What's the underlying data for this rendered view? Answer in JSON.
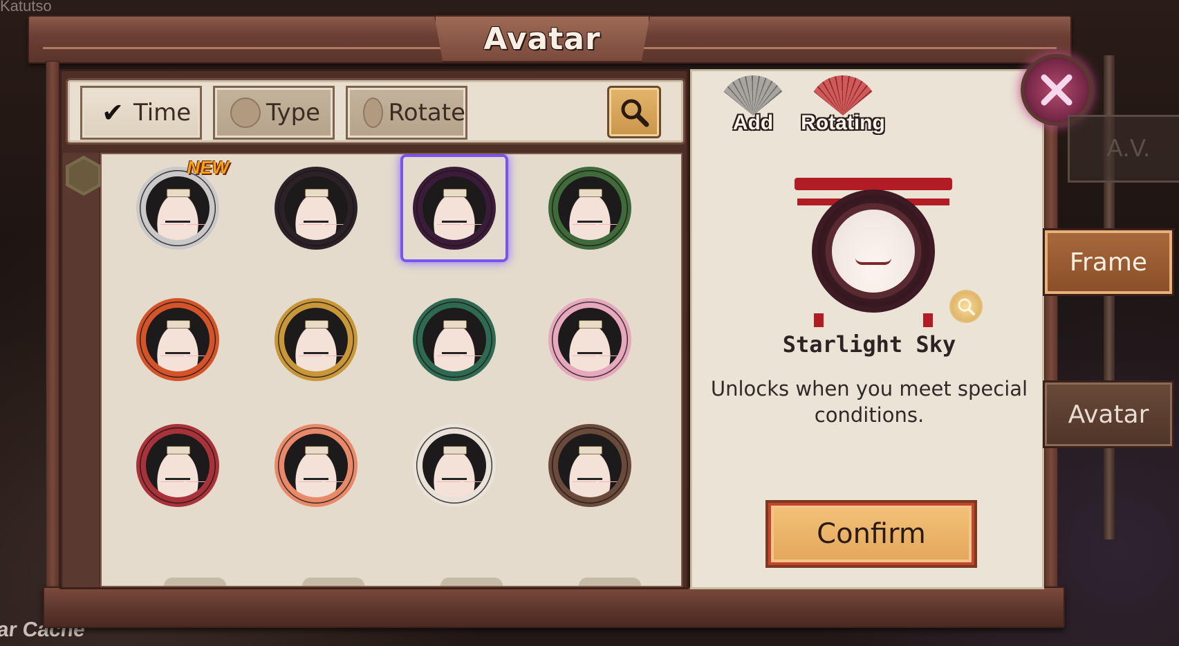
{
  "background": {
    "top_left_text": "Katutso",
    "bottom_left_text": "ar Cache"
  },
  "window": {
    "title": "Avatar"
  },
  "filters": {
    "items": [
      {
        "label": "Time",
        "checked": true
      },
      {
        "label": "Type",
        "checked": false
      },
      {
        "label": "Rotate",
        "checked": false
      }
    ],
    "check_glyph": "✔",
    "search_icon": "search-icon"
  },
  "grid": {
    "new_badge": "NEW",
    "items": [
      {
        "name": "frame-silver-8",
        "ring_color": "#c9c9c9",
        "is_new": true,
        "selected": false
      },
      {
        "name": "frame-default",
        "ring_color": "#2a2226",
        "is_new": false,
        "selected": false
      },
      {
        "name": "frame-starlight-sky",
        "ring_color": "#3a1c3a",
        "is_new": false,
        "selected": true
      },
      {
        "name": "frame-serpent-green",
        "ring_color": "#3f6a3a",
        "is_new": false,
        "selected": false
      },
      {
        "name": "frame-autumn-leaf",
        "ring_color": "#d4542a",
        "is_new": false,
        "selected": false
      },
      {
        "name": "frame-golden-blade",
        "ring_color": "#c8973a",
        "is_new": false,
        "selected": false
      },
      {
        "name": "frame-green-vine",
        "ring_color": "#2e6a52",
        "is_new": false,
        "selected": false
      },
      {
        "name": "frame-sakura-gold",
        "ring_color": "#e6a8bc",
        "is_new": false,
        "selected": false
      },
      {
        "name": "frame-oni-festival",
        "ring_color": "#a8323a",
        "is_new": false,
        "selected": false
      },
      {
        "name": "frame-coral-bloom",
        "ring_color": "#e88a6a",
        "is_new": false,
        "selected": false
      },
      {
        "name": "frame-white-fox",
        "ring_color": "#e8e2d8",
        "is_new": false,
        "selected": false
      },
      {
        "name": "frame-pink-blossom",
        "ring_color": "#6a4a3a",
        "is_new": false,
        "selected": false
      }
    ]
  },
  "detail": {
    "add_label": "Add",
    "rotating_label": "Rotating",
    "frame_name": "Starlight Sky",
    "description": "Unlocks when you meet special conditions.",
    "confirm_label": "Confirm",
    "colors": {
      "add_fan": "#a8a4a0",
      "rotating_fan": "#d05a5a"
    }
  },
  "side_tabs": {
    "av_label": "A.V.",
    "frame_label": "Frame",
    "avatar_label": "Avatar",
    "active": "Frame"
  },
  "colors": {
    "selected_outline": "#7a54f0",
    "new_badge": "#f6a31c",
    "confirm_button": "#e3a55a",
    "close_button": "#b44a6e"
  }
}
